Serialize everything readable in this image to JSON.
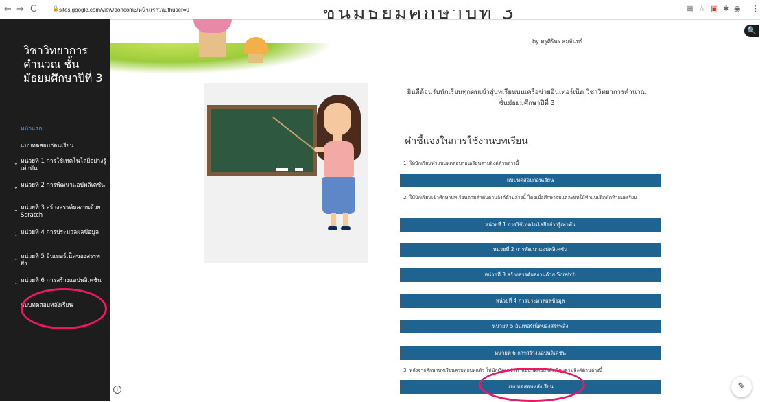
{
  "browser": {
    "nav_buttons": [
      "←",
      "→",
      "C"
    ],
    "url": "sites.google.com/view/doncom3/หน้าแรก?authuser=0",
    "extension_icons": [
      "▤",
      "☆",
      "▣",
      "✱",
      "◉",
      "⋮"
    ]
  },
  "site": {
    "title": "วิชาวิทยาการคำนวณ ชั้นมัธยมศึกษาปีที่ 3",
    "heading": "ชั้นมัธยมศึกษาปีที่ 3",
    "byline": "by ครูศิริพร สมจันทร์"
  },
  "sidebar": {
    "items": [
      {
        "label": "หน้าแรก",
        "active": true
      },
      {
        "label": "แบบทดสอบก่อนเรียน",
        "expandable": false
      },
      {
        "label": "หน่วยที่ 1 การใช้เทคโนโลยีอย่างรู้เท่าทัน",
        "expandable": true
      },
      {
        "label": "หน่วยที่ 2 การพัฒนาแอปพลิเคชัน",
        "expandable": true
      },
      {
        "label": "หน่วยที่ 3 สร้างสรรค์ผลงานด้วย Scratch",
        "expandable": true
      },
      {
        "label": "หน่วยที่ 4 การประมวลผลข้อมูล",
        "expandable": true
      },
      {
        "label": "หน่วยที่ 5 อินเทอร์เน็ตของสรรพสิ่ง",
        "expandable": true
      },
      {
        "label": "หน่วยที่ 6 การสร้างแอปพลิเคชัน",
        "expandable": true
      },
      {
        "label": "แบบทดสอบหลังเรียน",
        "expandable": false
      }
    ]
  },
  "main": {
    "welcome": "ยินดีต้อนรับนักเรียนทุกคนเข้าสู่บทเรียนบนเครือข่ายอินเทอร์เน็ต วิชาวิทยาการคำนวณ ชั้นมัธยมศึกษาปีที่ 3",
    "instructions_heading": "คำชี้แจงในการใช้งานบทเรียน",
    "steps": [
      "1. ให้นักเรียนทำแบบทดสอบก่อนเรียนตามลิงค์ด้านล่างนี้",
      "2. ให้นักเรียนเข้าศึกษาบทเรียนตามลำดับตามลิงค์ด้านล่างนี้ โดยเมื่อศึกษาจบแต่ละบทให้ทำแบบฝึกหัดท้ายบทเรียน",
      "3. หลังจากศึกษาบทเรียนครบทุกบทแล้ว ให้นักเรียนเข้าทำแบบทดสอบหลังเรียนตามลิงค์ด้านล่างนี้"
    ],
    "buttons": [
      "แบบทดสอบก่อนเรียน",
      "หน่วยที่ 1 การใช้เทคโนโลยีอย่างรู้เท่าทัน",
      "หน่วยที่ 2 การพัฒนาแอปพลิเคชัน",
      "หน่วยที่ 3 สร้างสรรค์ผลงานด้วย Scratch",
      "หน่วยที่ 4 การประมวลผลข้อมูล",
      "หน่วยที่ 5 อินเทอร์เน็ตของสรรพสิ่ง",
      "หน่วยที่ 6 การสร้างแอปพลิเคชัน",
      "แบบทดสอบหลังเรียน"
    ]
  },
  "icons": {
    "search": "🔍",
    "info": "i",
    "edit": "✎",
    "chevron": "⌄"
  },
  "colors": {
    "sidebar_bg": "#1d1d1d",
    "active_link": "#4fa5e6",
    "button_bg": "#1f6391",
    "annotation": "#ec1862"
  }
}
